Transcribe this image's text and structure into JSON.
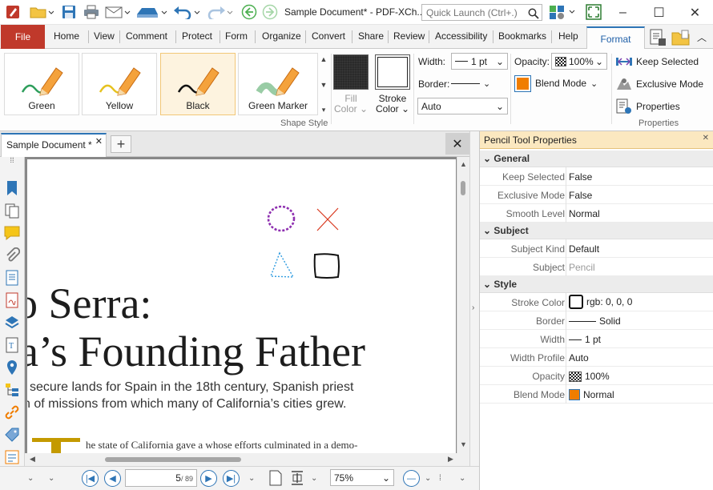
{
  "window": {
    "doc_title": "Sample Document* - PDF-XCh..",
    "quick_launch_placeholder": "Quick Launch (Ctrl+.)",
    "minimize_glyph": "–",
    "maximize_glyph": "☐",
    "close_glyph": "✕"
  },
  "menu": {
    "file": "File",
    "tabs": [
      "Home",
      "View",
      "Comment",
      "Protect",
      "Form",
      "Organize",
      "Convert",
      "Share",
      "Review",
      "Accessibility",
      "Bookmarks",
      "Help"
    ],
    "active_tab": "Format"
  },
  "ribbon": {
    "shape_style": {
      "tools": [
        "Green",
        "Yellow",
        "Black",
        "Green Marker"
      ],
      "selected_tool": "Black",
      "group_label": "Shape Style"
    },
    "fill_color_label": "Fill",
    "fill_color_label2": "Color",
    "stroke_color_label": "Stroke",
    "stroke_color_label2": "Color",
    "width_label": "Width:",
    "width_value": "1 pt",
    "border_label": "Border:",
    "line_mode_value": "Auto",
    "opacity_label": "Opacity:",
    "opacity_value": "100%",
    "blend_mode_label": "Blend Mode",
    "properties_group": {
      "keep_selected": "Keep Selected",
      "exclusive_mode": "Exclusive Mode",
      "properties": "Properties",
      "group_label": "Properties"
    }
  },
  "document": {
    "tab_label": "Sample Document *",
    "heading_line1": "o Serra:",
    "heading_line2": "a’s Founding Father",
    "body_line1": "secure lands for Spain in the 18th century, Spanish priest",
    "body_line2": "n of missions from which many of California’s cities grew.",
    "body_line3": "he state of California gave a    whose efforts culminated in a demo-"
  },
  "status": {
    "page_current": "5",
    "page_total": "/ 89",
    "zoom": "75%"
  },
  "properties_panel": {
    "title": "Pencil Tool Properties",
    "sections": {
      "general": "General",
      "subject": "Subject",
      "style": "Style"
    },
    "rows": {
      "keep_selected": {
        "key": "Keep Selected",
        "value": "False"
      },
      "exclusive_mode": {
        "key": "Exclusive Mode",
        "value": "False"
      },
      "smooth_level": {
        "key": "Smooth Level",
        "value": "Normal"
      },
      "subject_kind": {
        "key": "Subject Kind",
        "value": "Default"
      },
      "subject": {
        "key": "Subject",
        "value": "Pencil"
      },
      "stroke_color": {
        "key": "Stroke Color",
        "value": "rgb: 0, 0, 0"
      },
      "border": {
        "key": "Border",
        "value": "Solid"
      },
      "width": {
        "key": "Width",
        "value": "1 pt"
      },
      "width_profile": {
        "key": "Width Profile",
        "value": "Auto"
      },
      "opacity": {
        "key": "Opacity",
        "value": "100%"
      },
      "blend_mode": {
        "key": "Blend Mode",
        "value": "Normal"
      }
    }
  },
  "colors": {
    "file_tab": "#c0392b",
    "accent": "#2e75b6",
    "panel_header": "#fbe8c0",
    "blend_orange": "#f07d00",
    "shape_purple": "#8e2fb0",
    "shape_red": "#d9381e",
    "shape_blue": "#2e9be0",
    "heading_gold": "#c49a00"
  }
}
